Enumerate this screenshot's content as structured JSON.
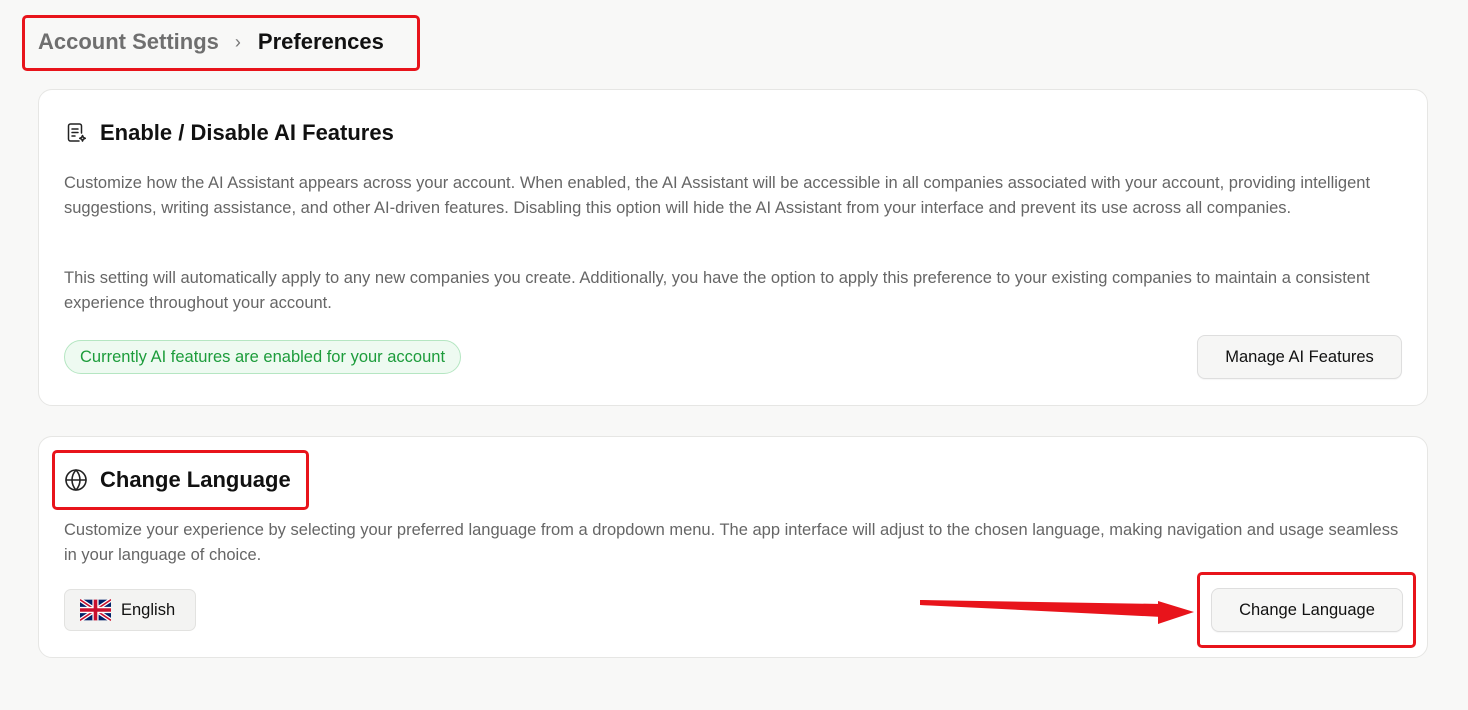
{
  "breadcrumb": {
    "parent": "Account Settings",
    "separator": "›",
    "current": "Preferences"
  },
  "ai_card": {
    "icon": "ai-document-icon",
    "title": "Enable / Disable AI Features",
    "description_1": "Customize how the AI Assistant appears across your account. When enabled, the AI Assistant will be accessible in all companies associated with your account, providing intelligent suggestions, writing assistance, and other AI-driven features. Disabling this option will hide the AI Assistant from your interface and prevent its use across all companies.",
    "description_2": "This setting will automatically apply to any new companies you create. Additionally, you have the option to apply this preference to your existing companies to maintain a consistent experience throughout your account.",
    "status": "Currently AI features are enabled for your account",
    "manage_button": "Manage AI Features"
  },
  "language_card": {
    "icon": "globe-icon",
    "title": "Change Language",
    "description": "Customize your experience by selecting your preferred language from a dropdown menu. The app interface will adjust to the chosen language, making navigation and usage seamless in your language of choice.",
    "current_language": "English",
    "current_language_flag": "uk-flag-icon",
    "change_button": "Change Language"
  },
  "colors": {
    "annotation": "#e8141b",
    "status_green": "#1c9c3b",
    "status_bg": "#eefaf1",
    "page_bg": "#f8f8f7"
  }
}
